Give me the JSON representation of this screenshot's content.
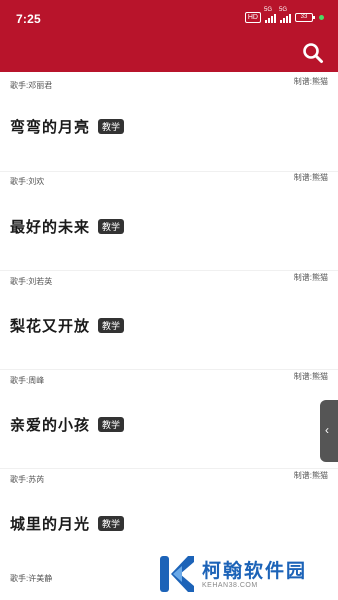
{
  "status": {
    "time": "7:25",
    "hd": "HD",
    "signal_1": "5G",
    "signal_2": "5G",
    "battery": "33"
  },
  "colors": {
    "header": "#b8142b",
    "tag_bg": "#333333",
    "watermark_blue": "#1c63b8"
  },
  "icons": {
    "search": "search-icon",
    "side": "chevron-left-icon"
  },
  "first_row": {
    "singer": "歌手:邓丽君",
    "maker": "制谱:熊猫"
  },
  "songs": [
    {
      "title": "弯弯的月亮",
      "tag": "教学",
      "singer": "歌手:刘欢",
      "maker": "制谱:熊猫"
    },
    {
      "title": "最好的未来",
      "tag": "教学",
      "singer": "歌手:刘若英",
      "maker": "制谱:熊猫"
    },
    {
      "title": "梨花又开放",
      "tag": "教学",
      "singer": "歌手:周峰",
      "maker": "制谱:熊猫"
    },
    {
      "title": "亲爱的小孩",
      "tag": "教学",
      "singer": "歌手:苏芮",
      "maker": "制谱:熊猫"
    },
    {
      "title": "城里的月光",
      "tag": "教学",
      "singer": "歌手:许美静",
      "maker": ""
    }
  ],
  "watermark": {
    "name": "柯翰软件园",
    "url": "KEHAN38.COM"
  }
}
